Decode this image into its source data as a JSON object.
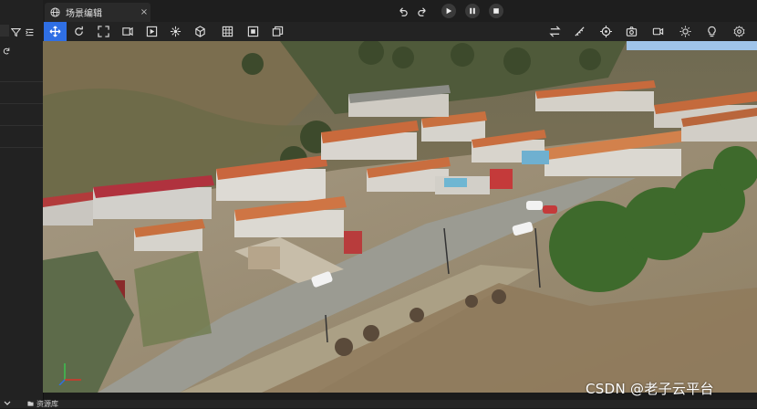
{
  "app": {
    "tab_title": "场景编辑",
    "tab_close": "×"
  },
  "playback": {
    "undo_icon": "undo-icon",
    "redo_icon": "redo-icon",
    "play_icon": "play-icon",
    "pause_icon": "pause-icon",
    "stop_icon": "stop-icon"
  },
  "toolbar": {
    "left_tools": [
      "move-tool-icon",
      "rotate-tool-icon",
      "scale-tool-icon",
      "transform-tool-icon",
      "frame-tool-icon",
      "anchor-tool-icon",
      "cube-tool-icon",
      "grid-tool-icon",
      "snap-tool-icon",
      "layers-tool-icon"
    ],
    "right_tools": [
      "swap-icon",
      "ruler-icon",
      "target-icon",
      "camera-icon",
      "video-icon",
      "sun-icon",
      "bulb-icon",
      "settings-icon"
    ]
  },
  "status": {
    "label": "资源库"
  },
  "watermark": {
    "text": "CSDN @老子云平台"
  },
  "colors": {
    "accent": "#2f6fe4",
    "panel": "#222222",
    "toolbar": "#232323"
  }
}
